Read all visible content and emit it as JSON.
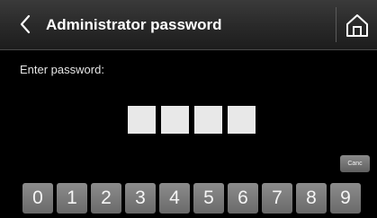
{
  "header": {
    "title": "Administrator password",
    "back_icon": "chevron-left-icon",
    "home_icon": "home-icon"
  },
  "prompt": "Enter password:",
  "pin": {
    "length": 4
  },
  "cancel_label": "Canc",
  "keypad": {
    "keys": [
      "0",
      "1",
      "2",
      "3",
      "4",
      "5",
      "6",
      "7",
      "8",
      "9"
    ]
  },
  "colors": {
    "background": "#000000",
    "header": "#2a2a2a",
    "key": "#7a7a7a",
    "pin_box": "#e8e8e8"
  }
}
